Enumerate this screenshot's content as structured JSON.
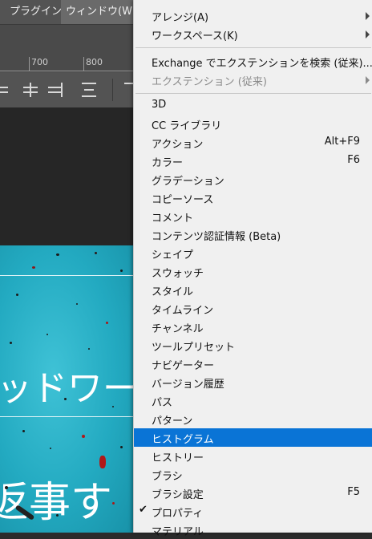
{
  "menubar": {
    "items": [
      {
        "label": "プラグイン"
      },
      {
        "label": "ウィンドウ(W)"
      }
    ]
  },
  "ruler": {
    "labels": [
      "700",
      "800"
    ]
  },
  "canvas": {
    "text_line1": "ッドワー",
    "text_line2": "返事す"
  },
  "window_menu": {
    "group1": [
      {
        "label": "アレンジ(A)",
        "submenu": true
      },
      {
        "label": "ワークスペース(K)",
        "submenu": true
      }
    ],
    "group2": [
      {
        "label": "Exchange でエクステンションを検索 (従来)...",
        "submenu": false
      },
      {
        "label": "エクステンション (従来)",
        "submenu": true,
        "disabled": true
      }
    ],
    "group3": [
      {
        "label": "3D"
      },
      {
        "label": "CC ライブラリ"
      },
      {
        "label": "アクション",
        "shortcut": "Alt+F9"
      },
      {
        "label": "カラー",
        "shortcut": "F6"
      },
      {
        "label": "グラデーション"
      },
      {
        "label": "コピーソース"
      },
      {
        "label": "コメント"
      },
      {
        "label": "コンテンツ認証情報 (Beta)"
      },
      {
        "label": "シェイプ"
      },
      {
        "label": "スウォッチ"
      },
      {
        "label": "スタイル"
      },
      {
        "label": "タイムライン"
      },
      {
        "label": "チャンネル"
      },
      {
        "label": "ツールプリセット"
      },
      {
        "label": "ナビゲーター"
      },
      {
        "label": "バージョン履歴"
      },
      {
        "label": "パス"
      },
      {
        "label": "パターン"
      },
      {
        "label": "ヒストグラム",
        "highlighted": true
      },
      {
        "label": "ヒストリー"
      },
      {
        "label": "ブラシ"
      },
      {
        "label": "ブラシ設定",
        "shortcut": "F5"
      },
      {
        "label": "プロパティ",
        "checked": true
      },
      {
        "label": "マテリアル"
      }
    ],
    "check_glyph": "✔",
    "highlight_color": "#0a74d6"
  }
}
